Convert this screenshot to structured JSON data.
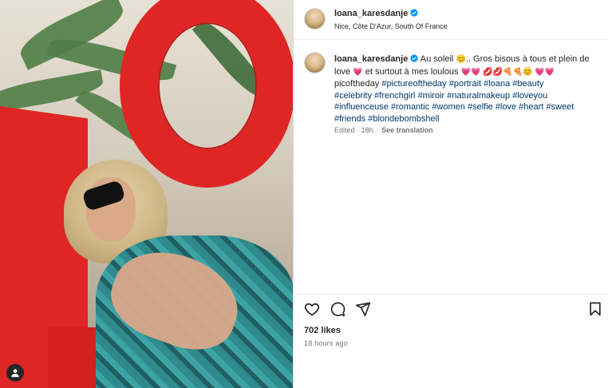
{
  "post": {
    "username": "loana_karesdanje",
    "location": "Nice, Côte D'Azur, South Of France",
    "caption": {
      "username": "loana_karesdanje",
      "line1_text": "Au soleil",
      "line1_emoji1": "😊",
      "line1_rest": ".. Gros bisous à tous et plein de",
      "line2_pre": "love",
      "line2_emoji": "💗",
      "line2_text": "et surtout à mes loulous",
      "line2_emojis": "💗💗 💋💋🍕🍕😊 💗💗",
      "line3_plain": "picoftheday",
      "hashtags_line3": [
        "#pictureoftheday",
        "#portrait",
        "#loana",
        "#beauty"
      ],
      "hashtags_line4": [
        "#celebrity",
        "#frenchgirl",
        "#miroir",
        "#naturalmakeup",
        "#loveyou"
      ],
      "hashtags_line5": [
        "#influenceuse",
        "#romantic",
        "#women",
        "#selfie",
        "#love",
        "#heart",
        "#sweet"
      ],
      "hashtags_line6": [
        "#friends",
        "#blondebombshell"
      ]
    },
    "meta": {
      "edited": "Edited · 18h",
      "see_translation": "See translation"
    },
    "likes": "702 likes",
    "time_ago": "18 hours ago"
  },
  "icons": {
    "like": "heart-icon",
    "comment": "comment-icon",
    "share": "share-icon",
    "save": "bookmark-icon",
    "verified": "verified-badge-icon",
    "user_tag": "user-tag-icon"
  },
  "colors": {
    "hashtag": "#00376b",
    "verified": "#0095f6",
    "muted": "#737373",
    "text": "#262626"
  }
}
